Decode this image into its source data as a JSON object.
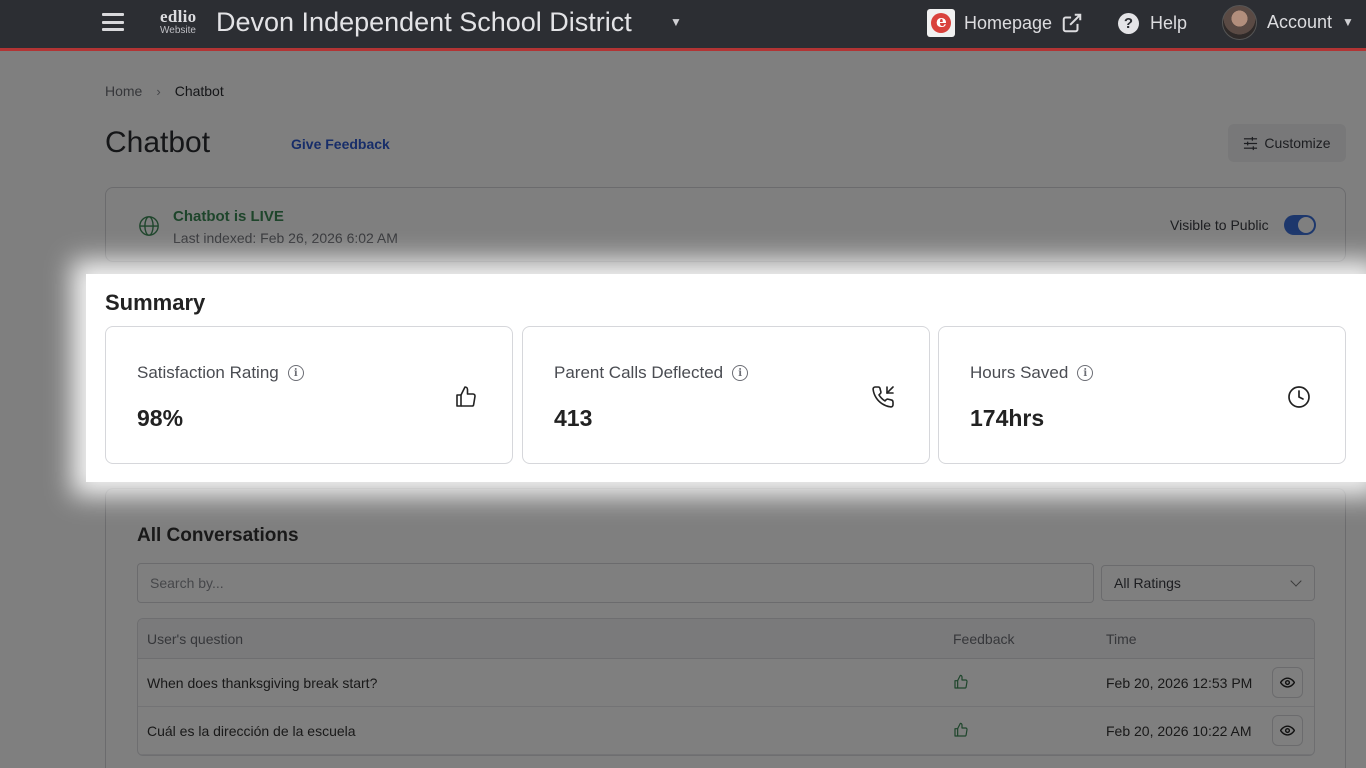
{
  "topbar": {
    "brand_top": "edlio",
    "brand_sub": "Website",
    "site_title": "Devon Independent School District",
    "homepage_label": "Homepage",
    "help_label": "Help",
    "account_label": "Account",
    "icons": [
      "menu-icon",
      "caret-down-icon",
      "edlio-logo",
      "external-link-icon",
      "help-icon",
      "avatar",
      "caret-down-icon"
    ]
  },
  "breadcrumb": {
    "home": "Home",
    "current": "Chatbot"
  },
  "header": {
    "title": "Chatbot",
    "feedback_link": "Give Feedback",
    "customize_label": "Customize"
  },
  "status": {
    "live_text": "Chatbot is LIVE",
    "indexed_text": "Last indexed: Feb 26, 2026 6:02 AM",
    "visible_label": "Visible to Public",
    "visible_on": true
  },
  "summary": {
    "title": "Summary",
    "metrics": [
      {
        "label": "Satisfaction Rating",
        "value": "98%",
        "icon": "thumbs-up-icon"
      },
      {
        "label": "Parent Calls Deflected",
        "value": "413",
        "icon": "phone-incoming-icon"
      },
      {
        "label": "Hours Saved",
        "value": "174hrs",
        "icon": "clock-icon"
      }
    ]
  },
  "conversations": {
    "title": "All Conversations",
    "search_placeholder": "Search by...",
    "rating_filter": "All Ratings",
    "columns": [
      "User's question",
      "Feedback",
      "Time"
    ],
    "rows": [
      {
        "question": "When does thanksgiving break start?",
        "feedback": "thumbs-up-icon",
        "time": "Feb 20, 2026 12:53 PM"
      },
      {
        "question": "Cuál es la dirección de la escuela",
        "feedback": "thumbs-up-icon",
        "time": "Feb 20, 2026 10:22 AM"
      }
    ]
  },
  "colors": {
    "topbar": "#2c2e33",
    "accent_red": "#b23434",
    "live_green": "#3d8a57",
    "link_blue": "#2f5bd3",
    "toggle_blue": "#3a6fd8"
  }
}
